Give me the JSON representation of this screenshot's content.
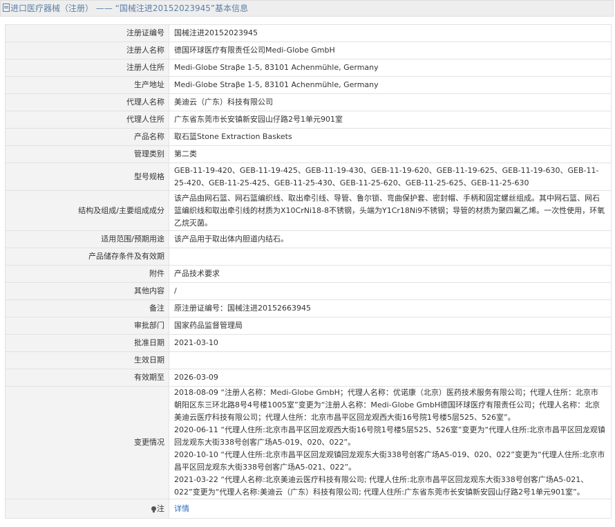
{
  "header": {
    "category": "进口医疗器械（注册）",
    "separator": "——",
    "title": "“国械注进20152023945”基本信息"
  },
  "rows": [
    {
      "label": "注册证编号",
      "value": "国械注进20152023945"
    },
    {
      "label": "注册人名称",
      "value": "德国环球医疗有限责任公司Medi-Globe GmbH"
    },
    {
      "label": "注册人住所",
      "value": "Medi-Globe Straβe 1-5, 83101 Achenmühle, Germany"
    },
    {
      "label": "生产地址",
      "value": "Medi-Globe Straβe 1-5, 83101 Achenmühle, Germany"
    },
    {
      "label": "代理人名称",
      "value": "美迪云（广东）科技有限公司"
    },
    {
      "label": "代理人住所",
      "value": "广东省东莞市长安镇新安园山仔路2号1单元901室"
    },
    {
      "label": "产品名称",
      "value": "取石篮Stone Extraction Baskets"
    },
    {
      "label": "管理类别",
      "value": "第二类"
    },
    {
      "label": "型号规格",
      "value": "GEB-11-19-420、GEB-11-19-425、GEB-11-19-430、GEB-11-19-620、GEB-11-19-625、GEB-11-19-630、GEB-11-25-420、GEB-11-25-425、GEB-11-25-430、GEB-11-25-620、GEB-11-25-625、GEB-11-25-630"
    },
    {
      "label": "结构及组成/主要组成成分",
      "value": "该产品由网石篮、网石篮编织线、取出牵引线、导管、鲁尔锁、弯曲保护套、密封帽、手柄和固定螺丝组成。其中网石篮、网石篮编织线和取出牵引线的材质为X10CrNi18-8不锈钢，头端为Y1Cr18Ni9不锈钢；导管的材质为聚四氟乙烯。一次性使用，环氧乙烷灭菌。"
    },
    {
      "label": "适用范围/预期用途",
      "value": "该产品用于取出体内胆道内结石。"
    },
    {
      "label": "产品储存条件及有效期",
      "value": ""
    },
    {
      "label": "附件",
      "value": "产品技术要求"
    },
    {
      "label": "其他内容",
      "value": "/"
    },
    {
      "label": "备注",
      "value": "原注册证编号：国械注进20152663945"
    },
    {
      "label": "审批部门",
      "value": "国家药品监督管理局"
    },
    {
      "label": "批准日期",
      "value": "2021-03-10"
    },
    {
      "label": "生效日期",
      "value": ""
    },
    {
      "label": "有效期至",
      "value": "2026-03-09"
    }
  ],
  "changes": {
    "label": "变更情况",
    "entries": [
      "2018-08-09 “注册人名称：Medi-Globe GmbH；代理人名称：优诺康（北京）医药技术服务有限公司；代理人住所：北京市朝阳区东三环北路8号4号楼1005室”变更为“注册人名称：Medi-Globe GmbH德国环球医疗有限责任公司；代理人名称：北京美迪云医疗科技有限公司；代理人住所：北京市昌平区回龙观西大街16号院1号楼5层525、526室”。",
      "2020-06-11 “代理人住所:北京市昌平区回龙观西大街16号院1号楼5层525、526室”变更为“代理人住所:北京市昌平区回龙观镇回龙观东大街338号创客广场A5-019、020、022”。",
      "2020-10-10 “代理人住所:北京市昌平区回龙观镇回龙观东大街338号创客广场A5-019、020、022”变更为“代理人住所:北京市昌平区回龙观东大街338号创客广场A5-021、022”。",
      "2021-03-22 “代理人名称:北京美迪云医疗科技有限公司; 代理人住所:北京市昌平区回龙观东大街338号创客广场A5-021、022”变更为“代理人名称:美迪云（广东）科技有限公司; 代理人住所:广东省东莞市长安镇新安园山仔路2号1单元901室”。"
    ]
  },
  "note": {
    "label": "注",
    "link": "详情"
  }
}
